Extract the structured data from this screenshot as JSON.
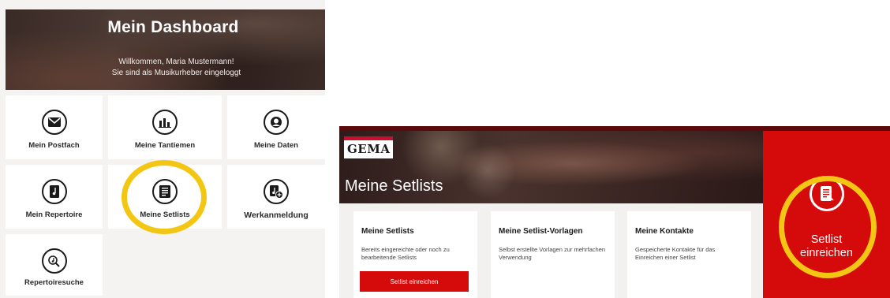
{
  "dashboard": {
    "title": "Mein Dashboard",
    "welcome_line1": "Willkommen, Maria Mustermann!",
    "welcome_line2": "Sie sind als Musikurheber eingeloggt",
    "tiles": [
      {
        "label": "Mein Postfach",
        "icon": "envelope-icon"
      },
      {
        "label": "Meine Tantiemen",
        "icon": "bar-chart-icon"
      },
      {
        "label": "Meine Daten",
        "icon": "user-icon"
      },
      {
        "label": "Mein Repertoire",
        "icon": "music-sheet-icon"
      },
      {
        "label": "Meine Setlists",
        "icon": "setlist-icon"
      },
      {
        "label": "Werkanmeldung",
        "icon": "work-add-icon"
      },
      {
        "label": "Repertoiresuche",
        "icon": "search-music-icon"
      }
    ]
  },
  "setlists": {
    "logo": "GEMA",
    "title": "Meine Setlists",
    "cta_line1": "Setlist",
    "cta_line2": "einreichen",
    "cards": [
      {
        "title": "Meine Setlists",
        "desc": "Bereits eingereichte oder noch zu bearbeitende Setlists",
        "button": "Setlist einreichen"
      },
      {
        "title": "Meine Setlist-Vorlagen",
        "desc": "Selbst erstellte Vorlagen zur mehrfachen Verwendung"
      },
      {
        "title": "Meine Kontakte",
        "desc": "Gespeicherte Kontakte für das Einreichen einer Setlist"
      }
    ]
  },
  "colors": {
    "accent_red": "#d50a0a",
    "highlight_ring": "#f3c614",
    "dark_strip": "#5a0a0a"
  }
}
